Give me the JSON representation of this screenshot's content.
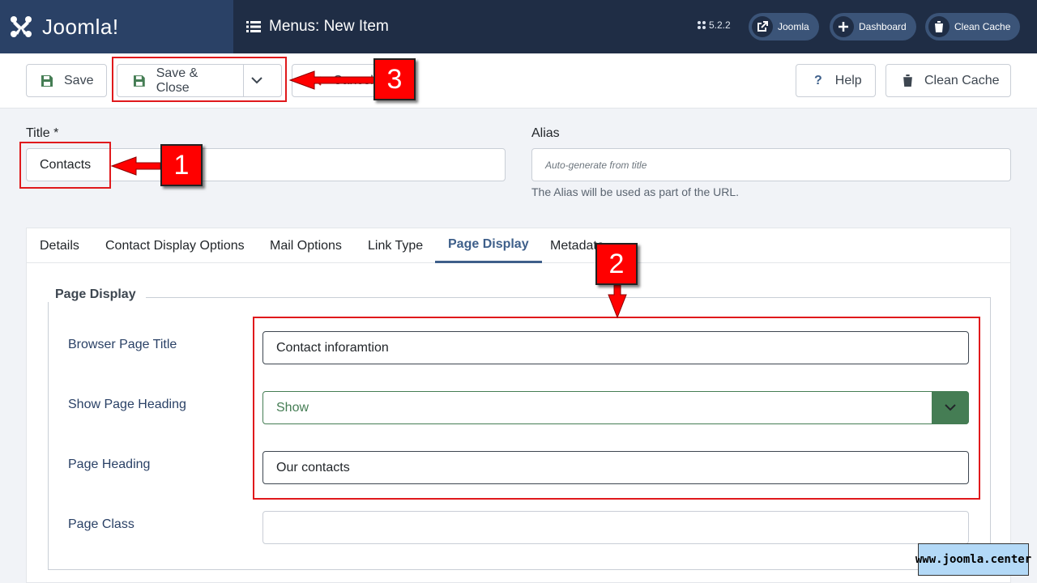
{
  "header": {
    "brand": "Joomla!",
    "page_title": "Menus: New Item",
    "version": "5.2.2",
    "buttons": [
      {
        "label": "Joomla",
        "icon": "external-link-icon"
      },
      {
        "label": "Dashboard",
        "icon": "plus-icon"
      },
      {
        "label": "Clean Cache",
        "icon": "trash-icon"
      }
    ]
  },
  "toolbar": {
    "save": "Save",
    "save_close": "Save & Close",
    "cancel": "Cancel",
    "help": "Help",
    "clean_cache": "Clean Cache"
  },
  "form": {
    "title_label": "Title *",
    "title_value": "Contacts",
    "alias_label": "Alias",
    "alias_placeholder": "Auto-generate from title",
    "alias_hint": "The Alias will be used as part of the URL."
  },
  "tabs": [
    "Details",
    "Contact Display Options",
    "Mail Options",
    "Link Type",
    "Page Display",
    "Metadata"
  ],
  "active_tab": "Page Display",
  "page_display": {
    "legend": "Page Display",
    "browser_title_label": "Browser Page Title",
    "browser_title_value": "Contact inforamtion",
    "show_heading_label": "Show Page Heading",
    "show_heading_value": "Show",
    "heading_label": "Page Heading",
    "heading_value": "Our contacts",
    "class_label": "Page Class",
    "class_value": ""
  },
  "annotations": {
    "one": "1",
    "two": "2",
    "three": "3"
  },
  "watermark": "www.joomla.center",
  "colors": {
    "header_bg": "#1f2d45",
    "brand_bg": "#2a4166",
    "accent": "#3e5f8a",
    "select_btn": "#457d54",
    "annotation_red": "#ff0000"
  }
}
